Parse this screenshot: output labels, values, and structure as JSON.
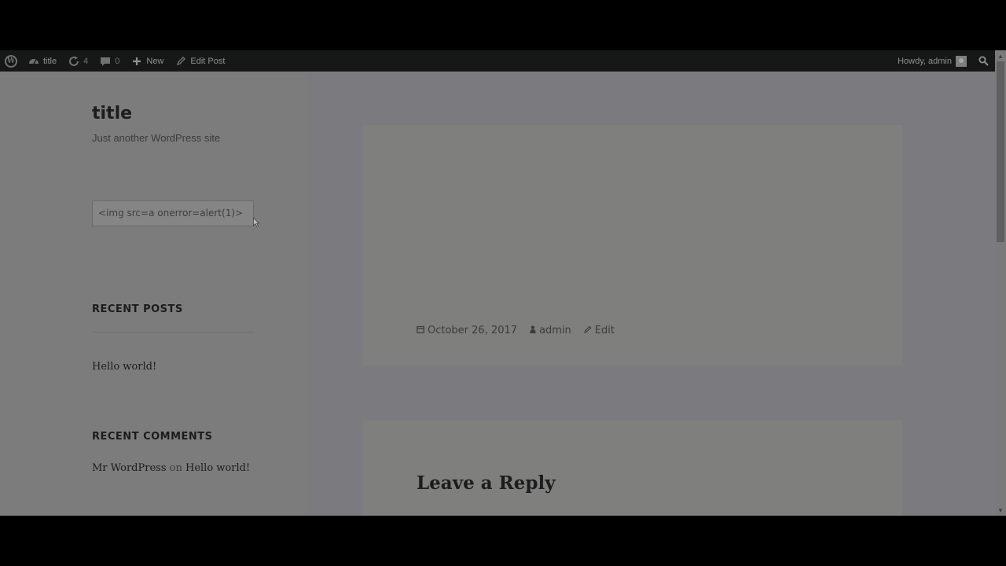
{
  "adminbar": {
    "site_name": "title",
    "updates_count": "4",
    "comments_count": "0",
    "new_label": "New",
    "edit_post_label": "Edit Post",
    "howdy_label": "Howdy, admin"
  },
  "sidebar": {
    "site_title": "title",
    "site_description": "Just another WordPress site",
    "search_value": "<img src=a onerror=alert(1)>",
    "recent_posts_title": "RECENT POSTS",
    "recent_posts": [
      "Hello world!"
    ],
    "recent_comments_title": "RECENT COMMENTS",
    "recent_comment": {
      "author": "Mr WordPress",
      "connector": "on",
      "post": "Hello world!"
    }
  },
  "post": {
    "date": "October 26, 2017",
    "author": "admin",
    "edit_label": "Edit"
  },
  "comments": {
    "reply_title": "Leave a Reply"
  },
  "icons": {
    "wordpress": "wordpress-icon",
    "dashboard": "dashboard-icon",
    "updates": "updates-icon",
    "comments": "comment-icon",
    "new": "plus-icon",
    "edit": "pencil-icon",
    "search": "search-icon",
    "calendar": "calendar-icon",
    "author": "user-icon"
  }
}
